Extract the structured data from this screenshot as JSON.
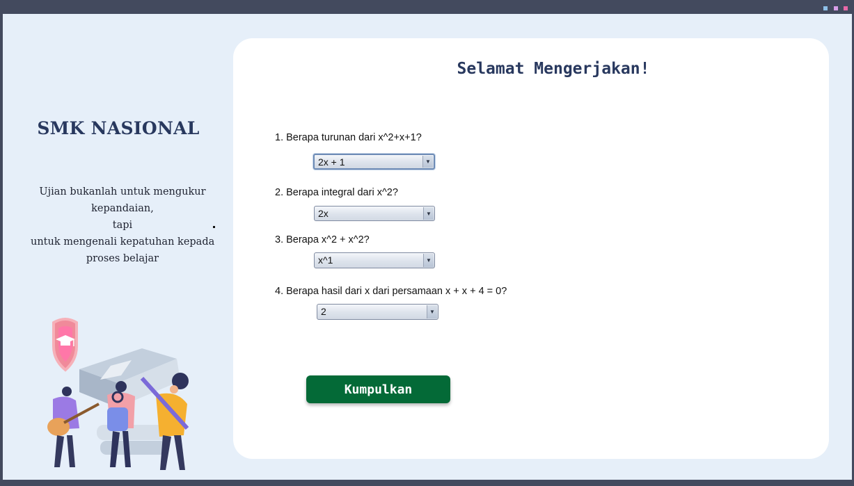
{
  "app": {
    "school_name": "SMK NASIONAL",
    "quote_lines": [
      "Ujian bukanlah untuk mengukur",
      "kepandaian,",
      "tapi",
      "untuk mengenali kepatuhan kepada",
      "proses belajar"
    ]
  },
  "exam": {
    "heading": "Selamat Mengerjakan!",
    "questions": [
      {
        "text": "1. Berapa turunan dari x^2+x+1?",
        "selected": "2x + 1"
      },
      {
        "text": "2. Berapa integral dari x^2?",
        "selected": "2x"
      },
      {
        "text": "3. Berapa x^2 + x^2?",
        "selected": "x^1"
      },
      {
        "text": "4. Berapa hasil dari x dari persamaan x + x + 4 = 0?",
        "selected": "2"
      }
    ],
    "submit_label": "Kumpulkan"
  },
  "icons": {
    "dropdown_arrow": "chevron-down-icon",
    "dropdown_glyph": "▼",
    "illustration": "students-with-graduation-badge-illustration"
  },
  "colors": {
    "window_frame": "#434a5e",
    "background": "#e6eff9",
    "panel": "#ffffff",
    "title_navy": "#28385e",
    "submit_green": "#046a37"
  }
}
